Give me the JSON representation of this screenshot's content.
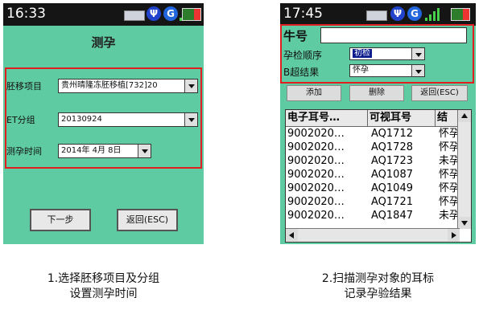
{
  "screen1": {
    "time": "16:33",
    "battery": "88%",
    "title": "测孕",
    "fields": [
      {
        "label": "胚移项目",
        "value": "贵州晴隆冻胚移植[732]20"
      },
      {
        "label": "ET分组",
        "value": "20130924"
      },
      {
        "label": "测孕时间",
        "value": "2014年  4月  8日"
      }
    ],
    "next_button": "下一步",
    "back_button": "返回(ESC)"
  },
  "screen2": {
    "time": "17:45",
    "battery": "88%",
    "cow_number_label": "牛号",
    "cow_number_value": "",
    "order_label": "孕检顺序",
    "order_value": "初检",
    "result_label": "B超结果",
    "result_value": "怀孕",
    "add_button": "添加",
    "delete_button": "删除",
    "back_button": "返回(ESC)",
    "columns": [
      "电子耳号…",
      "可视耳号",
      "结"
    ],
    "rows": [
      [
        "9002020…",
        "AQ1712",
        "怀孕"
      ],
      [
        "9002020…",
        "AQ1728",
        "怀孕"
      ],
      [
        "9002020…",
        "AQ1723",
        "未孕"
      ],
      [
        "9002020…",
        "AQ1087",
        "怀孕"
      ],
      [
        "9002020…",
        "AQ1049",
        "怀孕"
      ],
      [
        "9002020…",
        "AQ1721",
        "怀孕"
      ],
      [
        "9002020…",
        "AQ1847",
        "未孕"
      ]
    ]
  },
  "captions": {
    "left_line1": "1.选择胚移项目及分组",
    "left_line2": "设置测孕时间",
    "right_line1": "2.扫描测孕对象的耳标",
    "right_line2": "记录孕验结果"
  },
  "colors": {
    "screen_bg": "#5fcba3",
    "highlight_box": "#e02020",
    "selection": "#0a1a8c"
  }
}
